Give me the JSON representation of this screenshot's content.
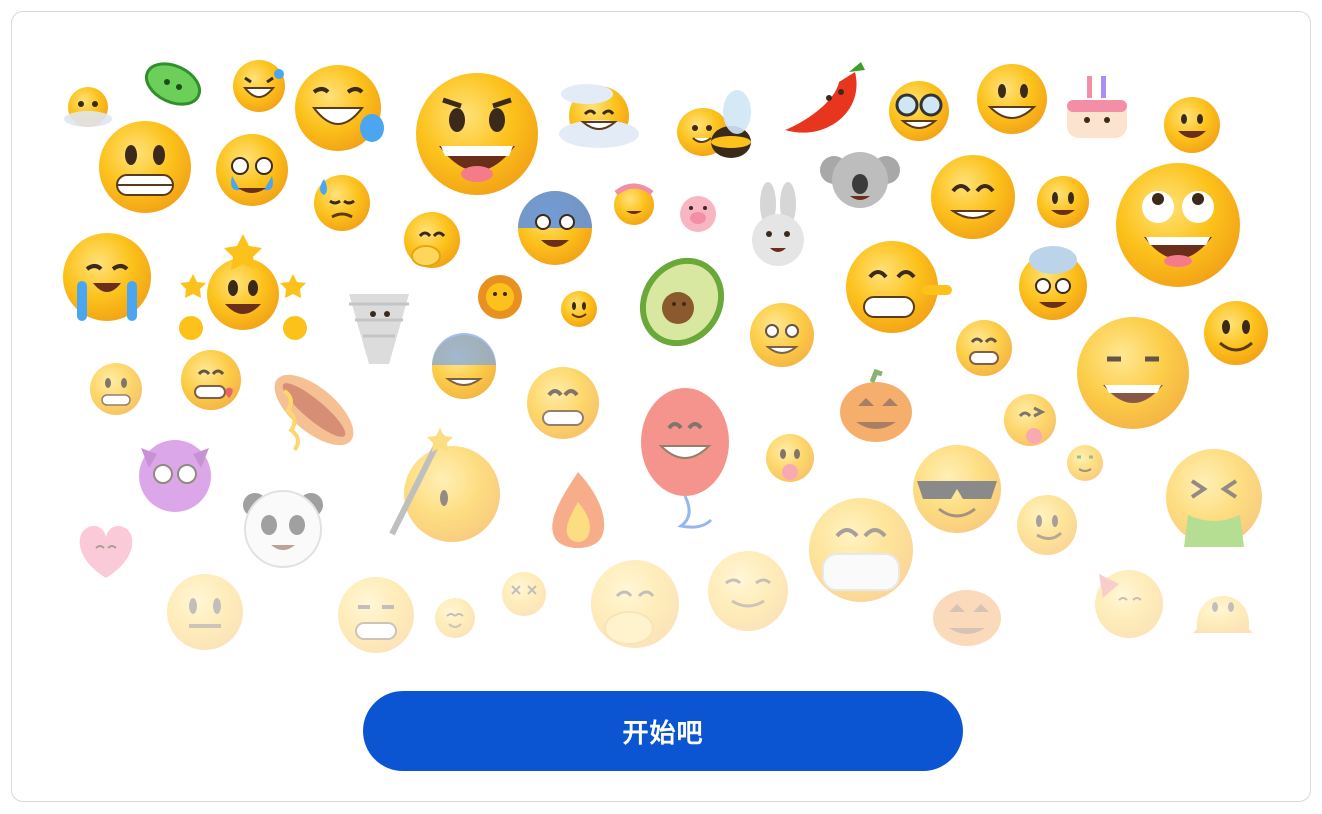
{
  "colors": {
    "button_background": "#0b55d2",
    "button_text": "#ffffff",
    "card_border": "#d9d9d9",
    "emoji_yellow": "#fcc21b"
  },
  "emoji_cloud": {
    "icons": [
      "fog-face-icon",
      "microbe-face-icon",
      "rolling-laughing-icon",
      "tears-of-joy-icon",
      "grinning-face-icon",
      "sun-behind-cloud-face-icon",
      "bee-face-icon",
      "hot-pepper-face-icon",
      "nerd-glasses-face-icon",
      "raised-eyebrow-face-icon",
      "birthday-cake-face-icon",
      "smiling-face-icon",
      "grimacing-face-icon",
      "holding-back-tears-icon",
      "downcast-sweat-face-icon",
      "hand-over-mouth-icon",
      "screaming-face-icon",
      "flower-crown-face-icon",
      "pig-face-icon",
      "rabbit-face-icon",
      "koala-face-icon",
      "smiling-eyes-face-icon",
      "rolling-eyes-face-icon",
      "crying-face-icon",
      "star-struck-face-icon",
      "tornado-face-icon",
      "lion-face-icon",
      "small-smile-face-icon",
      "avocado-face-icon",
      "lying-face-icon",
      "exploding-head-icon",
      "slight-smile-face-icon",
      "grinning-heart-face-icon",
      "cold-sweat-face-icon",
      "hot-dog-face-icon",
      "grin-face-icon",
      "balloon-face-icon",
      "jack-o-lantern-icon",
      "tongue-out-face-icon",
      "smirking-face-icon",
      "devil-pleading-face-icon",
      "magic-wand-face-icon",
      "fire-face-icon",
      "sunglasses-face-icon",
      "money-face-icon",
      "vomiting-face-icon",
      "panda-face-icon",
      "heart-face-icon",
      "medical-mask-face-icon",
      "neutral-face-icon",
      "smirk-grin-face-icon",
      "tiny-smile-face-icon",
      "dizzy-face-icon",
      "yawning-face-icon",
      "lenny-face-icon",
      "party-face-icon",
      "melting-face-icon"
    ]
  },
  "cta": {
    "label": "开始吧"
  }
}
